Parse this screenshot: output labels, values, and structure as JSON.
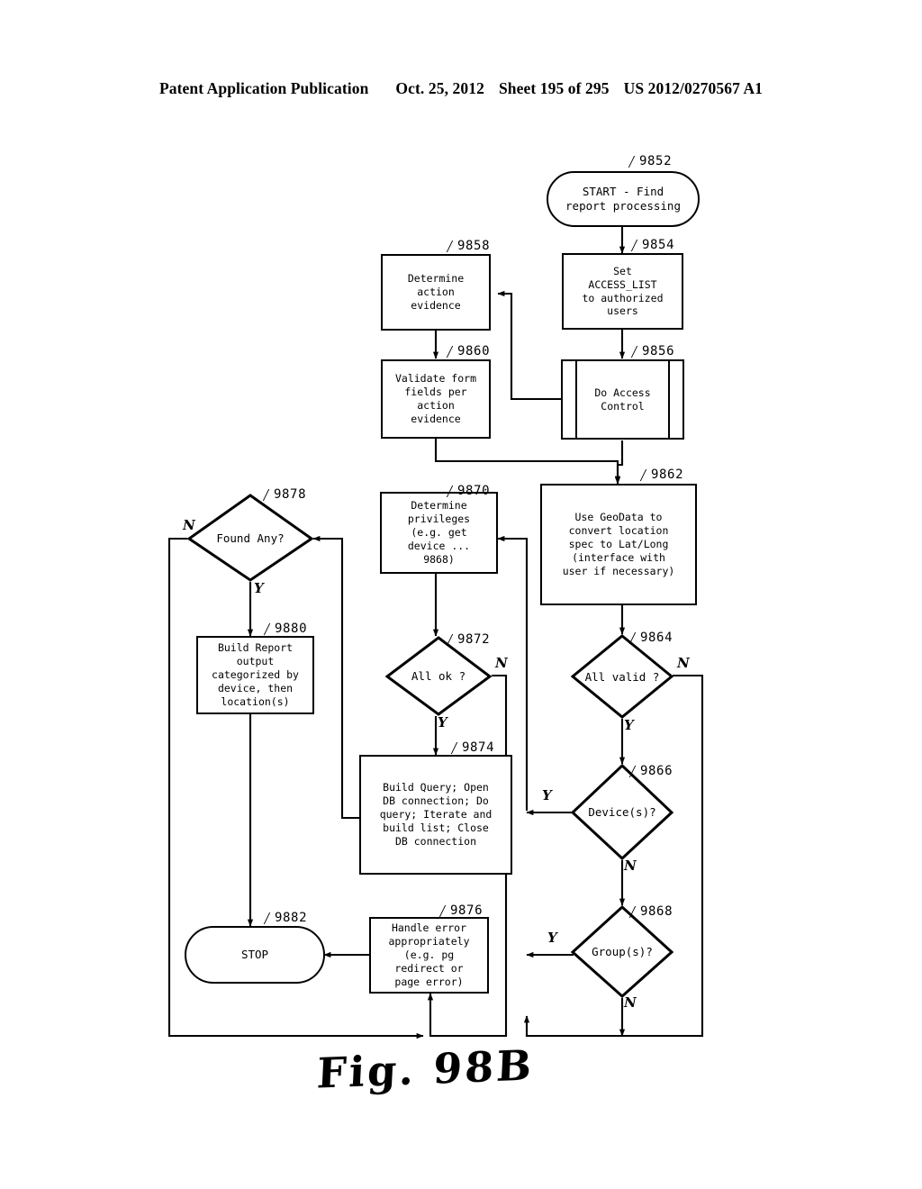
{
  "header": {
    "publication": "Patent Application Publication",
    "date": "Oct. 25, 2012",
    "sheet": "Sheet 195 of 295",
    "number": "US 2012/0270567 A1"
  },
  "figure": {
    "caption": "Fig. 98B"
  },
  "diagram": {
    "title": "Find report processing flowchart",
    "nodes": [
      {
        "id": "9852",
        "ref": "9852",
        "shape": "terminator",
        "text": "START - Find\nreport processing"
      },
      {
        "id": "9854",
        "ref": "9854",
        "shape": "process",
        "text": "Set\nACCESS_LIST\nto authorized\nusers"
      },
      {
        "id": "9856",
        "ref": "9856",
        "shape": "predefined",
        "text": "Do Access\nControl"
      },
      {
        "id": "9858",
        "ref": "9858",
        "shape": "process",
        "text": "Determine\naction\nevidence"
      },
      {
        "id": "9860",
        "ref": "9860",
        "shape": "process",
        "text": "Validate form\nfields per\naction\nevidence"
      },
      {
        "id": "9862",
        "ref": "9862",
        "shape": "process",
        "text": "Use GeoData to\nconvert location\nspec to Lat/Long\n(interface with\nuser if necessary)"
      },
      {
        "id": "9864",
        "ref": "9864",
        "shape": "decision",
        "text": "All valid ?"
      },
      {
        "id": "9866",
        "ref": "9866",
        "shape": "decision",
        "text": "Device(s)?"
      },
      {
        "id": "9868",
        "ref": "9868",
        "shape": "decision",
        "text": "Group(s)?"
      },
      {
        "id": "9870",
        "ref": "9870",
        "shape": "process",
        "text": "Determine\nprivileges\n(e.g. get\ndevice ...\n9868)"
      },
      {
        "id": "9872",
        "ref": "9872",
        "shape": "decision",
        "text": "All ok ?"
      },
      {
        "id": "9874",
        "ref": "9874",
        "shape": "process",
        "text": "Build Query; Open\nDB connection; Do\nquery; Iterate and\nbuild list; Close\nDB connection"
      },
      {
        "id": "9876",
        "ref": "9876",
        "shape": "process",
        "text": "Handle error\nappropriately\n(e.g. pg\nredirect or\npage error)"
      },
      {
        "id": "9878",
        "ref": "9878",
        "shape": "decision",
        "text": "Found Any?"
      },
      {
        "id": "9880",
        "ref": "9880",
        "shape": "process",
        "text": "Build Report\noutput\ncategorized by\ndevice, then\nlocation(s)"
      },
      {
        "id": "9882",
        "ref": "9882",
        "shape": "terminator",
        "text": "STOP"
      }
    ],
    "branch_labels": {
      "d9864_no": "N",
      "d9864_yes": "Y",
      "d9866_yes": "Y",
      "d9866_no": "N",
      "d9868_yes": "Y",
      "d9868_no": "N",
      "d9872_no": "N",
      "d9872_yes": "Y",
      "d9878_no": "N",
      "d9878_yes": "Y"
    },
    "edges": [
      {
        "from": "9852",
        "to": "9854",
        "label": ""
      },
      {
        "from": "9854",
        "to": "9856",
        "label": ""
      },
      {
        "from": "9856",
        "to": "9858",
        "label": ""
      },
      {
        "from": "9856",
        "to": "9862",
        "label": ""
      },
      {
        "from": "9858",
        "to": "9860",
        "label": ""
      },
      {
        "from": "9860",
        "to": "9862",
        "label": ""
      },
      {
        "from": "9862",
        "to": "9864",
        "label": ""
      },
      {
        "from": "9864",
        "to": "9866",
        "label": "Y"
      },
      {
        "from": "9864",
        "to": "bottom-bus",
        "label": "N"
      },
      {
        "from": "9866",
        "to": "9870",
        "label": "Y"
      },
      {
        "from": "9866",
        "to": "9868",
        "label": "N"
      },
      {
        "from": "9868",
        "to": "9870",
        "label": "Y"
      },
      {
        "from": "9868",
        "to": "bottom-bus",
        "label": "N"
      },
      {
        "from": "9870",
        "to": "9872",
        "label": ""
      },
      {
        "from": "9872",
        "to": "9874",
        "label": "Y"
      },
      {
        "from": "9872",
        "to": "9876",
        "label": "N"
      },
      {
        "from": "9874",
        "to": "9878",
        "label": ""
      },
      {
        "from": "9878",
        "to": "9880",
        "label": "Y"
      },
      {
        "from": "9878",
        "to": "bottom-bus",
        "label": "N"
      },
      {
        "from": "9880",
        "to": "9882",
        "label": ""
      },
      {
        "from": "9876",
        "to": "9882",
        "label": ""
      }
    ]
  },
  "colors": {
    "ink": "#000000",
    "paper": "#ffffff"
  }
}
